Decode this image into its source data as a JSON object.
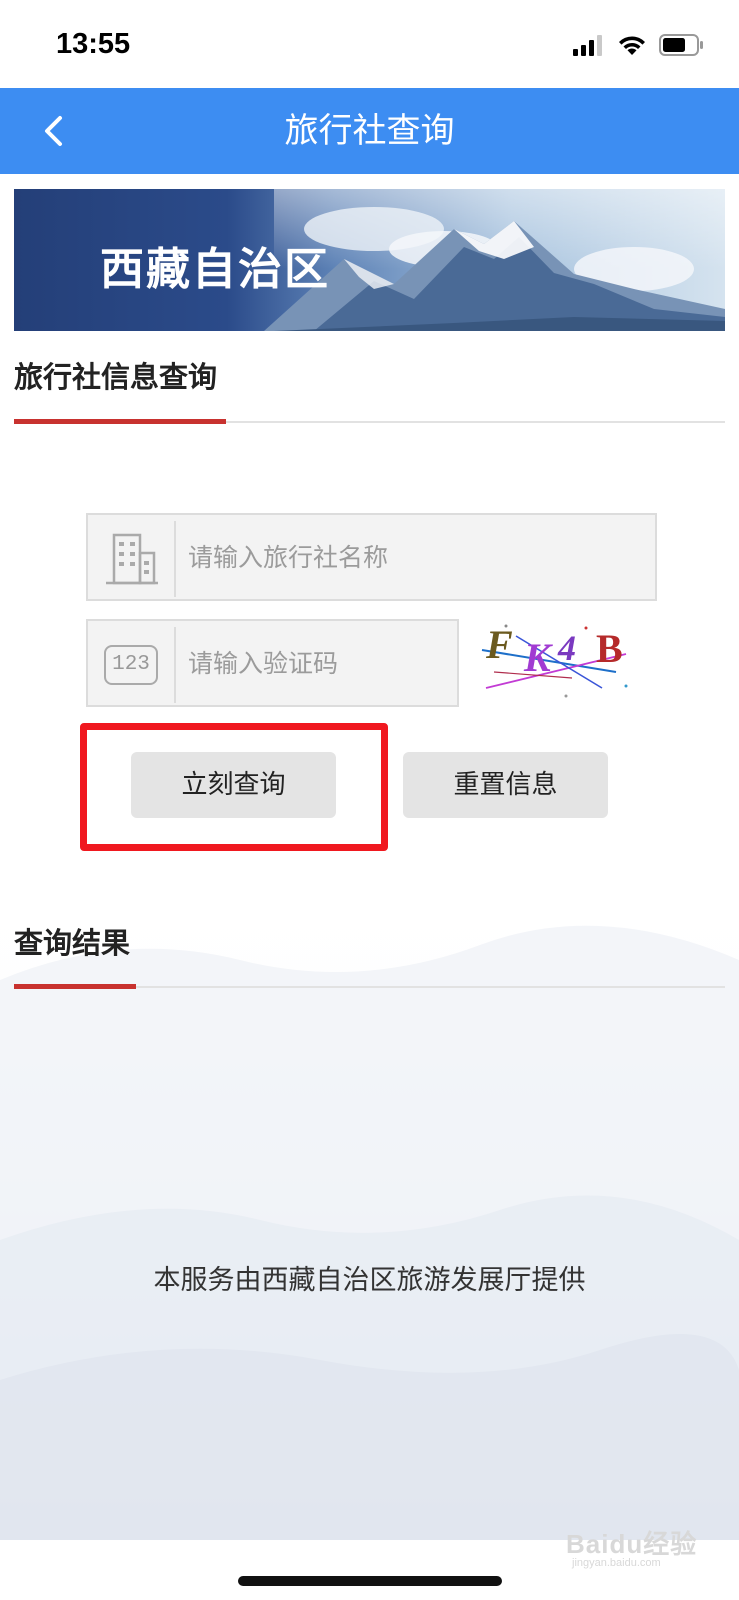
{
  "status_bar": {
    "time": "13:55"
  },
  "nav": {
    "title": "旅行社查询",
    "back_icon": "chevron-left-icon"
  },
  "banner": {
    "title": "西藏自治区"
  },
  "query_section": {
    "title": "旅行社信息查询",
    "name_input": {
      "placeholder": "请输入旅行社名称",
      "value": "",
      "icon": "building-icon"
    },
    "captcha_input": {
      "placeholder": "请输入验证码",
      "value": "",
      "icon": "123-icon",
      "icon_text": "123"
    },
    "captcha_text": "FK4B",
    "query_button": "立刻查询",
    "reset_button": "重置信息"
  },
  "result_section": {
    "title": "查询结果"
  },
  "footer": {
    "text": "本服务由西藏自治区旅游发展厅提供"
  },
  "watermark": {
    "text": "Baidu经验",
    "sub": "jingyan.baidu.com"
  },
  "colors": {
    "nav": "#3d8df2",
    "accent": "#c8322f",
    "highlight": "#f0181f"
  }
}
